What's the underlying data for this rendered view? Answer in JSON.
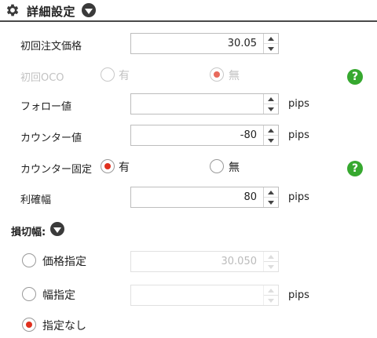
{
  "header": {
    "title": "詳細設定",
    "gear_icon": "gear-icon",
    "toggle_icon": "chevron-down-icon"
  },
  "initial_order_price": {
    "label": "初回注文価格",
    "value": "30.05"
  },
  "initial_oco": {
    "label": "初回OCO",
    "options": [
      "有",
      "無"
    ],
    "selected": "無"
  },
  "follow_value": {
    "label": "フォロー値",
    "value": "",
    "unit": "pips"
  },
  "counter_value": {
    "label": "カウンター値",
    "value": "-80",
    "unit": "pips"
  },
  "counter_fixed": {
    "label": "カウンター固定",
    "options": [
      "有",
      "無"
    ],
    "selected": "有"
  },
  "profit_width": {
    "label": "利確幅",
    "value": "80",
    "unit": "pips"
  },
  "stop_loss": {
    "title": "損切幅:",
    "price_spec": {
      "label": "価格指定",
      "value": "30.050"
    },
    "width_spec": {
      "label": "幅指定",
      "value": "",
      "unit": "pips"
    },
    "none": {
      "label": "指定なし"
    },
    "selected": "指定なし"
  },
  "help_icon": {
    "glyph": "?",
    "color": "#36a82f"
  },
  "colors": {
    "accent_red": "#e0301e",
    "help_green": "#36a82f",
    "header_rule": "#4a4a4a"
  }
}
